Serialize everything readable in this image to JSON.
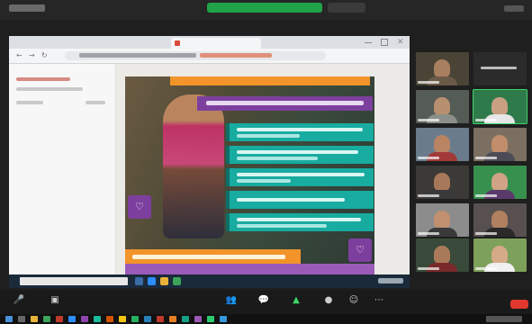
{
  "window": {
    "title": "",
    "share_status": "",
    "stop_label": "",
    "view_label": ""
  },
  "browser": {
    "tab_title": "",
    "url": "",
    "sidebar_items": [
      "",
      "",
      "",
      ""
    ]
  },
  "slide": {
    "banner_text": "",
    "bullets": [
      "",
      "",
      "",
      "",
      ""
    ],
    "bottom_text": "",
    "logo_glyph": "♡"
  },
  "taskbar": {
    "search_placeholder": "",
    "clock": ""
  },
  "gallery": {
    "participants": [
      "",
      "",
      "",
      "",
      "",
      "",
      "",
      "",
      "",
      "",
      "",
      ""
    ],
    "active_speaker_index": 3
  },
  "controls": {
    "left": [
      {
        "icon": "microphone-icon",
        "glyph": "🎤",
        "label": ""
      },
      {
        "icon": "video-camera-icon",
        "glyph": "▣",
        "label": ""
      }
    ],
    "center": [
      {
        "icon": "participants-icon",
        "glyph": "👥",
        "label": ""
      },
      {
        "icon": "chat-icon",
        "glyph": "💬",
        "label": ""
      },
      {
        "icon": "share-screen-icon",
        "glyph": "▲",
        "label": ""
      },
      {
        "icon": "record-icon",
        "glyph": "●",
        "label": ""
      },
      {
        "icon": "reactions-icon",
        "glyph": "☺",
        "label": ""
      },
      {
        "icon": "more-icon",
        "glyph": "⋯",
        "label": ""
      }
    ],
    "end_label": ""
  },
  "colors": {
    "zoom_green": "#21a34a",
    "slide_purple": "#7d3f9e",
    "slide_teal": "#18aba0",
    "slide_orange": "#f2942a",
    "end_red": "#e0382c"
  }
}
